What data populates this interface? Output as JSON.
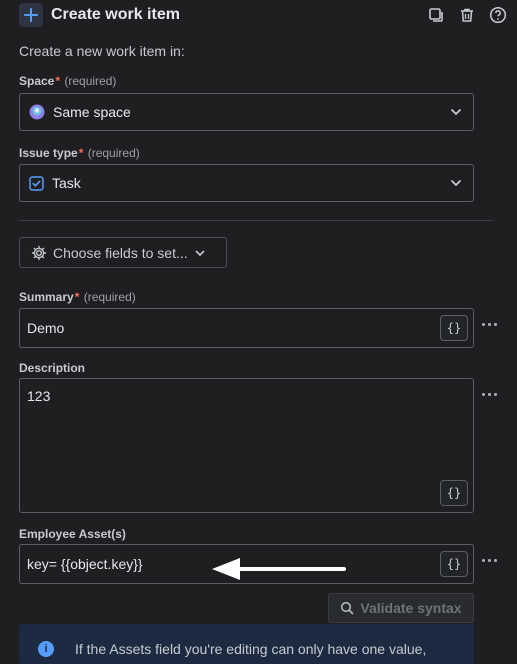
{
  "header": {
    "title": "Create work item",
    "icons": [
      "plus-icon",
      "duplicate-icon",
      "trash-icon",
      "help-icon"
    ]
  },
  "intro": "Create a new work item in:",
  "space": {
    "label": "Space",
    "required_marker": "*",
    "required_text": "(required)",
    "value": "Same space"
  },
  "issue_type": {
    "label": "Issue type",
    "required_marker": "*",
    "required_text": "(required)",
    "value": "Task"
  },
  "choose_fields": {
    "label": "Choose fields to set..."
  },
  "summary": {
    "label": "Summary",
    "required_marker": "*",
    "required_text": "(required)",
    "value": "Demo",
    "smart_value_button": "{}"
  },
  "description": {
    "label": "Description",
    "value": "123",
    "smart_value_button": "{}"
  },
  "employee_asset": {
    "label": "Employee Asset(s)",
    "value": "key= {{object.key}}",
    "smart_value_button": "{}"
  },
  "validate": {
    "label": "Validate syntax"
  },
  "info_banner": {
    "icon": "i",
    "text": "If the Assets field you're editing can only have one value,"
  },
  "colors": {
    "background": "#1f1f21",
    "required": "#ff6b5f",
    "info_background": "#1c2b41",
    "info_icon": "#579dff",
    "task_icon": "#579dff"
  }
}
